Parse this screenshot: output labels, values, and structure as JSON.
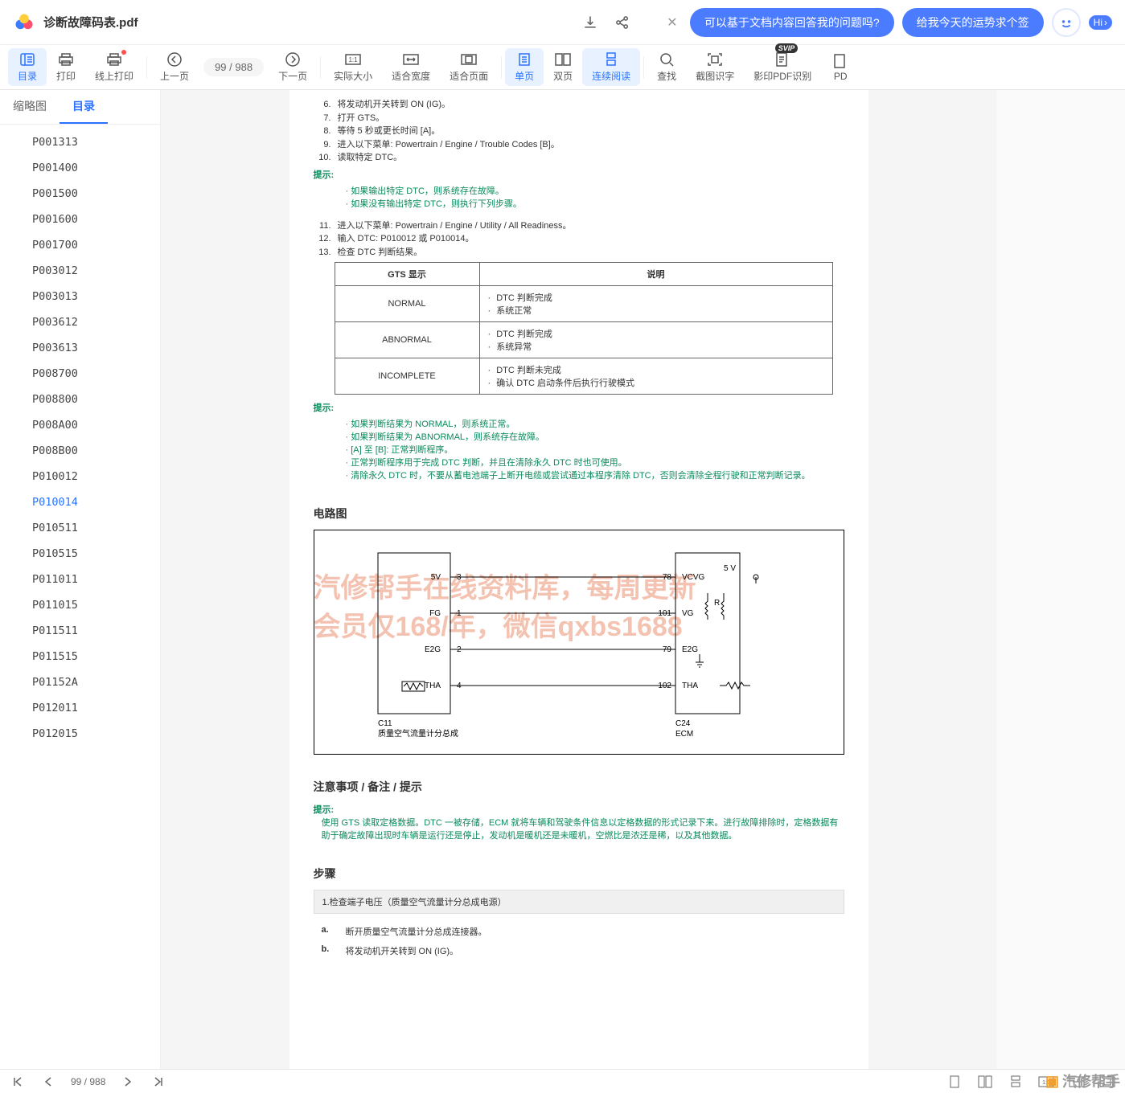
{
  "header": {
    "filename": "诊断故障码表.pdf",
    "suggest1": "可以基于文档内容回答我的问题吗?",
    "suggest2": "给我今天的运势求个签",
    "hi": "Hi"
  },
  "toolbar": {
    "toc": "目录",
    "print": "打印",
    "webprint": "线上打印",
    "prev": "上一页",
    "pageind": "99 / 988",
    "next": "下一页",
    "actual": "实际大小",
    "fitwidth": "适合宽度",
    "fitpage": "适合页面",
    "single": "单页",
    "double": "双页",
    "continuous": "连续阅读",
    "find": "查找",
    "ocrshot": "截图识字",
    "ocrpdf": "影印PDF识别",
    "pdf_more": "PD"
  },
  "sidetabs": {
    "thumbs": "缩略图",
    "toc": "目录"
  },
  "toc": [
    "P001313",
    "P001400",
    "P001500",
    "P001600",
    "P001700",
    "P003012",
    "P003013",
    "P003612",
    "P003613",
    "P008700",
    "P008800",
    "P008A00",
    "P008B00",
    "P010012",
    "P010014",
    "P010511",
    "P010515",
    "P011011",
    "P011015",
    "P011511",
    "P011515",
    "P01152A",
    "P012011",
    "P012015"
  ],
  "toc_active": "P010014",
  "doc": {
    "steps_a": [
      {
        "n": "6.",
        "t": "将发动机开关转到 ON (IG)。"
      },
      {
        "n": "7.",
        "t": "打开 GTS。"
      },
      {
        "n": "8.",
        "t": "等待 5 秒或更长时间 [A]。"
      },
      {
        "n": "9.",
        "t": "进入以下菜单: Powertrain / Engine / Trouble Codes [B]。"
      },
      {
        "n": "10.",
        "t": "读取特定 DTC。"
      }
    ],
    "hint1": "提示:",
    "hint1_items": [
      "如果输出特定 DTC，则系统存在故障。",
      "如果没有输出特定 DTC，则执行下列步骤。"
    ],
    "steps_b": [
      {
        "n": "11.",
        "t": "进入以下菜单: Powertrain / Engine / Utility / All Readiness。"
      },
      {
        "n": "12.",
        "t": "输入 DTC: P010012 或 P010014。"
      },
      {
        "n": "13.",
        "t": "检查 DTC 判断结果。"
      }
    ],
    "table": {
      "h1": "GTS 显示",
      "h2": "说明",
      "rows": [
        {
          "c1": "NORMAL",
          "c2": [
            "DTC 判断完成",
            "系统正常"
          ]
        },
        {
          "c1": "ABNORMAL",
          "c2": [
            "DTC 判断完成",
            "系统异常"
          ]
        },
        {
          "c1": "INCOMPLETE",
          "c2": [
            "DTC 判断未完成",
            "确认 DTC 启动条件后执行行驶模式"
          ]
        }
      ]
    },
    "hint2_items": [
      "如果判断结果为 NORMAL，则系统正常。",
      "如果判断结果为 ABNORMAL，则系统存在故障。",
      "[A] 至 [B]: 正常判断程序。",
      "正常判断程序用于完成 DTC 判断，并且在清除永久 DTC 时也可使用。",
      "清除永久 DTC 时，不要从蓄电池端子上断开电缆或尝试通过本程序清除 DTC，否则会清除全程行驶和正常判断记录。"
    ],
    "sec_circuit": "电路图",
    "diagram": {
      "left_name": "C11",
      "left_desc": "质量空气流量计分总成",
      "right_name": "C24",
      "right_desc": "ECM",
      "wires": [
        {
          "l": "5V",
          "lp": "3",
          "rp": "78",
          "r": "VCVG",
          "extra": "5 V"
        },
        {
          "l": "FG",
          "lp": "1",
          "rp": "101",
          "r": "VG",
          "extra": "R"
        },
        {
          "l": "E2G",
          "lp": "2",
          "rp": "79",
          "r": "E2G",
          "extra": ""
        },
        {
          "l": "THA",
          "lp": "4",
          "rp": "102",
          "r": "THA",
          "extra": ""
        }
      ]
    },
    "watermark1": "汽修帮手在线资料库，每周更新",
    "watermark2": "会员仅168/年，微信qxbs1688",
    "sec_notes": "注意事项 / 备注 / 提示",
    "notes_hint_label": "提示:",
    "notes_hint_body": "使用 GTS 读取定格数据。DTC 一被存储，ECM 就将车辆和驾驶条件信息以定格数据的形式记录下来。进行故障排除时，定格数据有助于确定故障出现时车辆是运行还是停止，发动机是暖机还是未暖机，空燃比是浓还是稀，以及其他数据。",
    "sec_steps": "步骤",
    "step1_title": "1.检查端子电压（质量空气流量计分总成电源）",
    "substeps": [
      {
        "l": "a.",
        "t": "断开质量空气流量计分总成连接器。"
      },
      {
        "l": "b.",
        "t": "将发动机开关转到 ON (IG)。"
      }
    ]
  },
  "footer": {
    "page": "99 / 988",
    "brand": "汽修帮手"
  }
}
